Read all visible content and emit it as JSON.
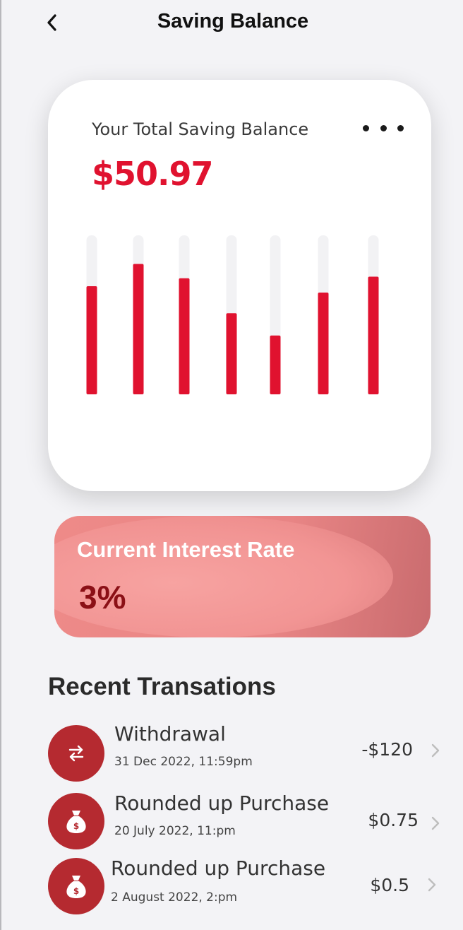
{
  "header": {
    "title": "Saving Balance",
    "back_icon": "chevron-left-icon"
  },
  "balance_card": {
    "label": "Your Total Saving Balance",
    "amount": "$50.97",
    "more_icon": "more-horizontal-icon",
    "accent_color": "#e0122f",
    "track_color": "#f2f2f4"
  },
  "chart_data": {
    "type": "bar",
    "values": [
      0.68,
      0.82,
      0.73,
      0.51,
      0.37,
      0.64,
      0.74
    ]
  },
  "interest": {
    "label": "Current Interest Rate",
    "value": "3%"
  },
  "transactions": {
    "title": "Recent Transations",
    "items": [
      {
        "title": "Withdrawal",
        "date": "31 Dec 2022, 11:59pm",
        "amount": "-$120",
        "icon": "transfer-arrows-icon"
      },
      {
        "title": "Rounded up Purchase",
        "date": "20 July 2022, 11:pm",
        "amount": "$0.75",
        "icon": "money-bag-icon"
      },
      {
        "title": "Rounded up Purchase",
        "date": "2 August 2022, 2:pm",
        "amount": "$0.5",
        "icon": "money-bag-icon"
      }
    ]
  }
}
